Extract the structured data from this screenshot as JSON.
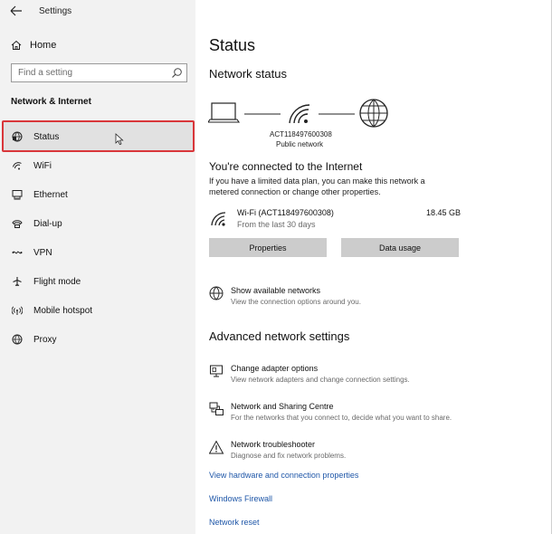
{
  "app": {
    "title": "Settings"
  },
  "sidebar": {
    "home_label": "Home",
    "search_placeholder": "Find a setting",
    "section_title": "Network & Internet",
    "items": [
      {
        "label": "Status",
        "icon": "status-globe-icon"
      },
      {
        "label": "WiFi",
        "icon": "wifi-icon"
      },
      {
        "label": "Ethernet",
        "icon": "ethernet-icon"
      },
      {
        "label": "Dial-up",
        "icon": "dialup-icon"
      },
      {
        "label": "VPN",
        "icon": "vpn-icon"
      },
      {
        "label": "Flight mode",
        "icon": "airplane-icon"
      },
      {
        "label": "Mobile hotspot",
        "icon": "hotspot-icon"
      },
      {
        "label": "Proxy",
        "icon": "globe-icon"
      }
    ],
    "highlight_color": "#d9363a"
  },
  "main": {
    "title": "Status",
    "network_status_heading": "Network status",
    "network_name": "ACT118497600308",
    "network_type": "Public network",
    "connected_title": "You're connected to the Internet",
    "connected_desc": "If you have a limited data plan, you can make this network a metered connection or change other properties.",
    "wifi": {
      "name": "Wi-Fi (ACT118497600308)",
      "sub": "From the last 30 days",
      "usage": "18.45 GB"
    },
    "buttons": {
      "properties": "Properties",
      "data_usage": "Data usage"
    },
    "show_networks": {
      "title": "Show available networks",
      "desc": "View the connection options around you."
    },
    "advanced_heading": "Advanced network settings",
    "advanced": [
      {
        "title": "Change adapter options",
        "desc": "View network adapters and change connection settings.",
        "icon": "adapter-monitor-icon"
      },
      {
        "title": "Network and Sharing Centre",
        "desc": "For the networks that you connect to, decide what you want to share.",
        "icon": "sharing-centre-icon"
      },
      {
        "title": "Network troubleshooter",
        "desc": "Diagnose and fix network problems.",
        "icon": "warning-icon"
      }
    ],
    "links": [
      "View hardware and connection properties",
      "Windows Firewall",
      "Network reset"
    ],
    "link_color": "#1f57a8"
  }
}
